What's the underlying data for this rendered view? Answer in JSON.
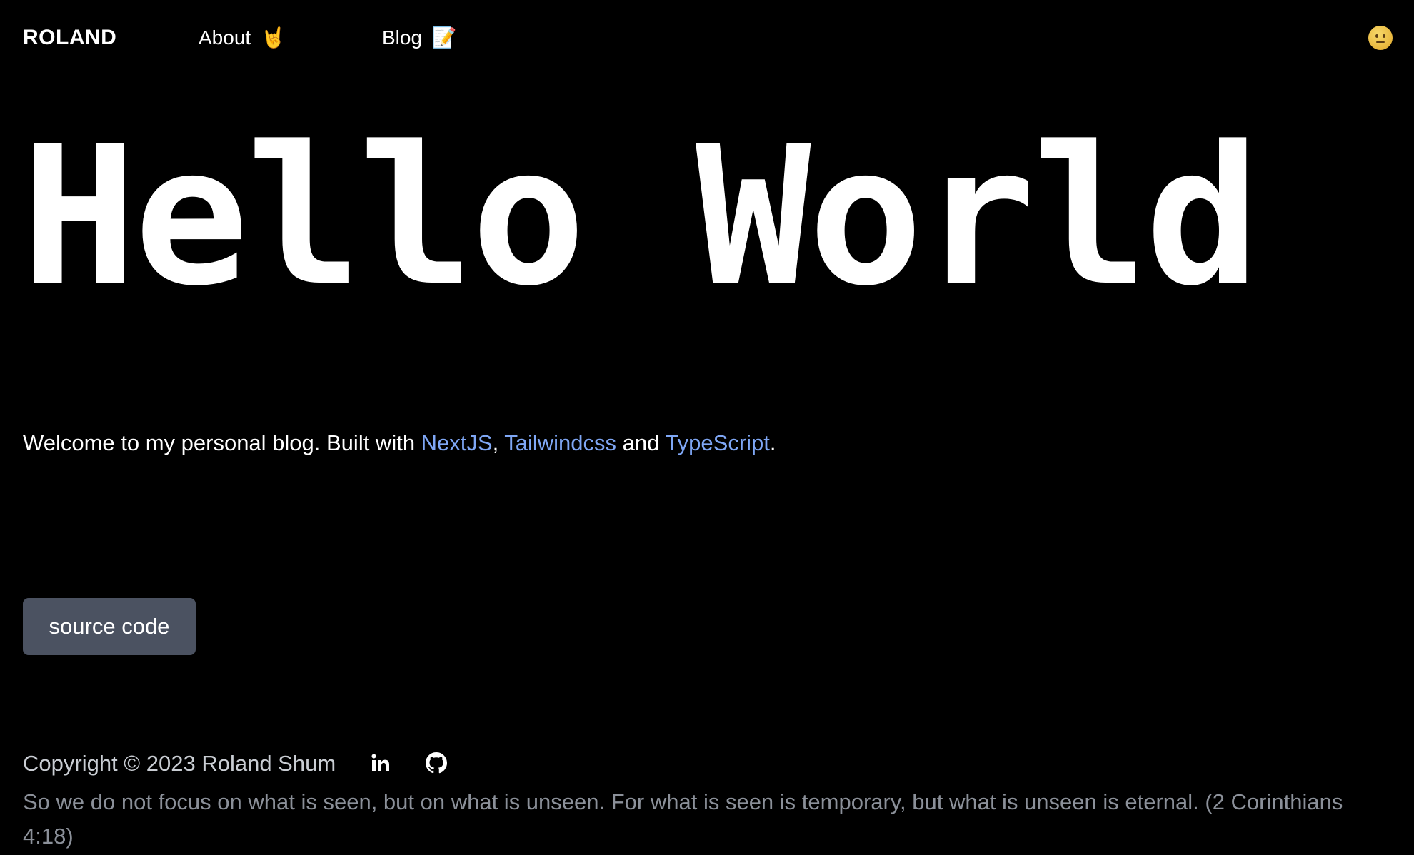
{
  "header": {
    "brand": "ROLAND",
    "nav": [
      {
        "label": "About",
        "emoji": "🤘"
      },
      {
        "label": "Blog",
        "emoji": "📝"
      }
    ],
    "theme_toggle_icon": "face-icon"
  },
  "hero": {
    "title": "Hello World"
  },
  "intro": {
    "prefix": "Welcome to my personal blog. Built with ",
    "link1": "NextJS",
    "sep1": ", ",
    "link2": "Tailwindcss",
    "sep2": " and ",
    "link3": "TypeScript",
    "suffix": "."
  },
  "source_button": {
    "label": "source code"
  },
  "footer": {
    "copyright": "Copyright © 2023 Roland Shum",
    "quote": "So we do not focus on what is seen, but on what is unseen. For what is seen is temporary, but what is unseen is eternal. (2 Corinthians 4:18)",
    "social": [
      "linkedin-icon",
      "github-icon"
    ]
  },
  "colors": {
    "background": "#000000",
    "link": "#7fa7f5",
    "button": "#4b5261",
    "muted": "#8b9099"
  }
}
